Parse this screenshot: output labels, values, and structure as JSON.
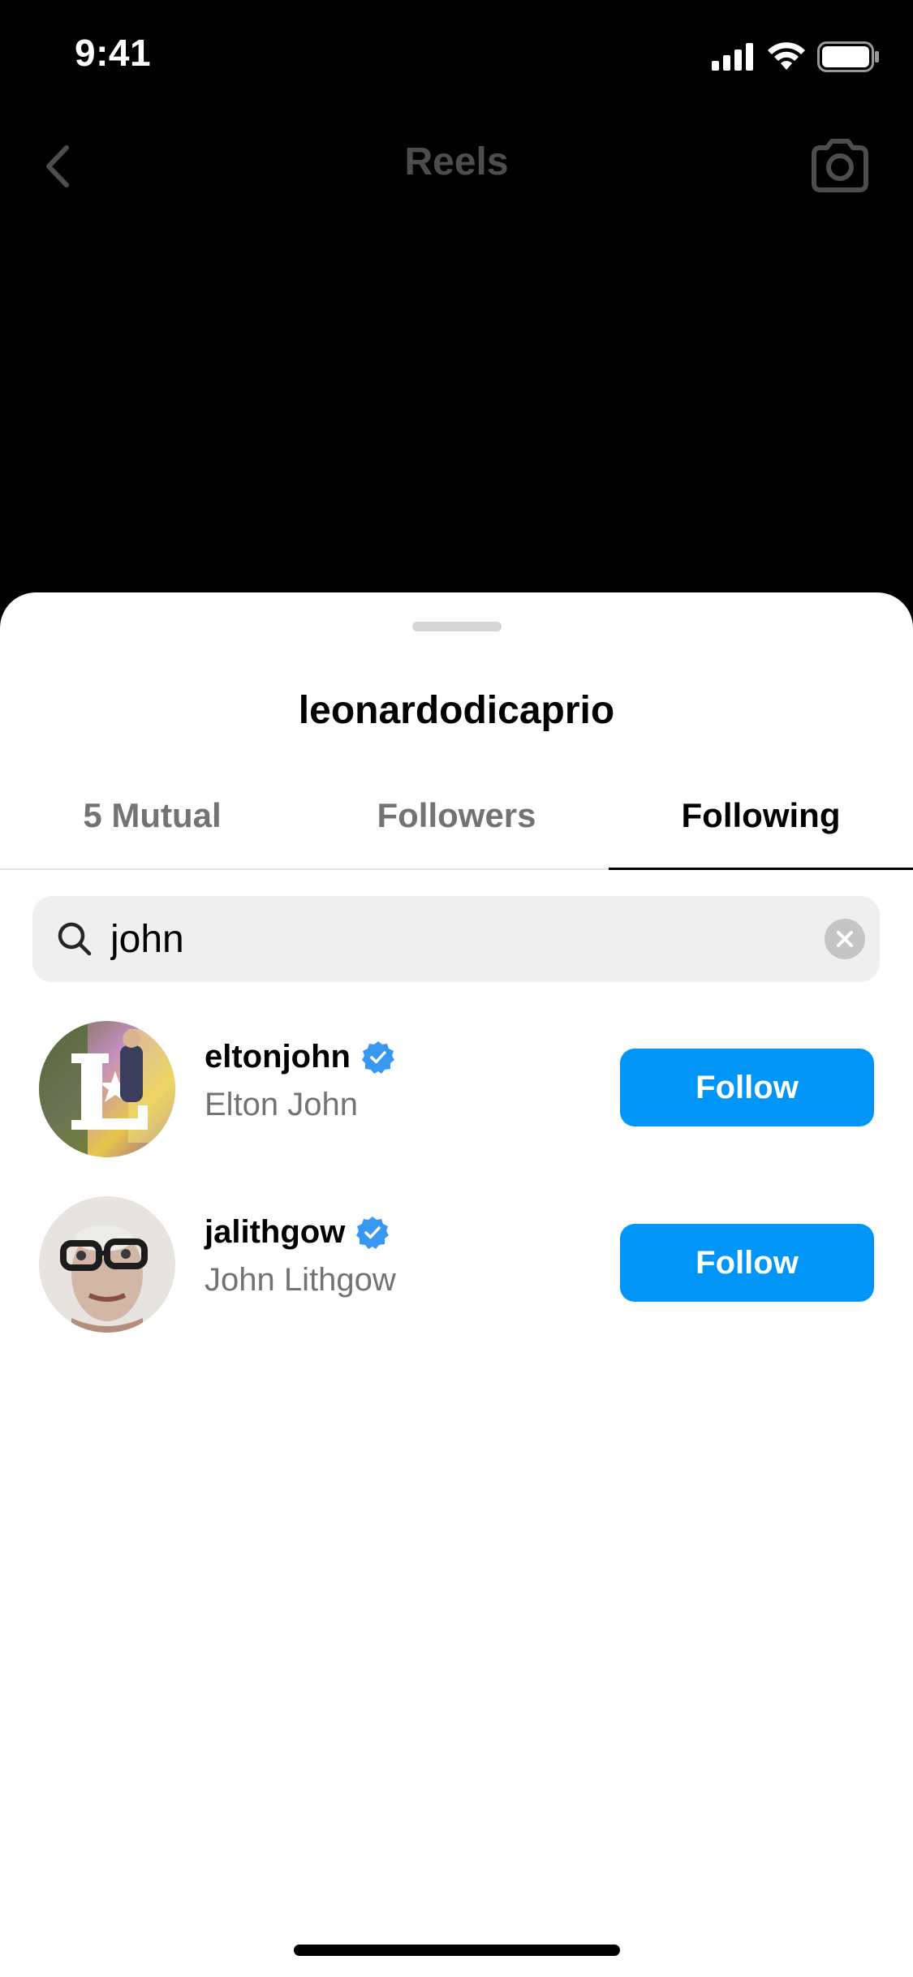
{
  "status_bar": {
    "time": "9:41",
    "icons": [
      "cellular-signal-icon",
      "wifi-icon",
      "battery-icon"
    ]
  },
  "background_screen": {
    "title": "Reels",
    "icons": [
      "back-chevron-icon",
      "camera-icon"
    ]
  },
  "sheet": {
    "title": "leonardodicaprio",
    "tabs": [
      {
        "label": "5 Mutual",
        "active": false
      },
      {
        "label": "Followers",
        "active": false
      },
      {
        "label": "Following",
        "active": true
      }
    ],
    "search": {
      "value": "john",
      "icon": "search-icon",
      "clear_icon": "clear-x-icon"
    },
    "results": [
      {
        "username": "eltonjohn",
        "full_name": "Elton John",
        "verified": true,
        "button_label": "Follow"
      },
      {
        "username": "jalithgow",
        "full_name": "John Lithgow",
        "verified": true,
        "button_label": "Follow"
      }
    ]
  },
  "colors": {
    "accent_blue": "#0095f6",
    "verified_blue": "#3897f0",
    "secondary_text": "#737373",
    "search_bg": "#efefef"
  }
}
